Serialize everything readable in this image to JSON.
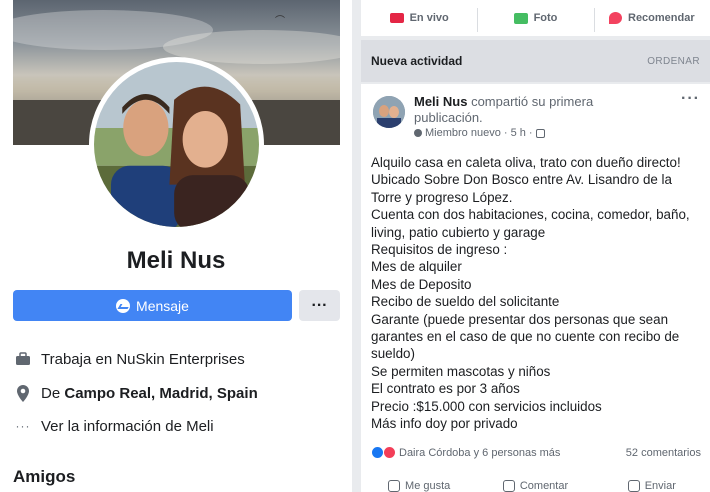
{
  "profile": {
    "name": "Meli Nus",
    "message_button": "Mensaje",
    "more_button": "···",
    "work": "Trabaja en NuSkin Enterprises",
    "location_prefix": "De ",
    "location": "Campo Real, Madrid, Spain",
    "see_info": "Ver la información de Meli",
    "friends_title": "Amigos"
  },
  "composer": {
    "live": "En vivo",
    "photo": "Foto",
    "recommend": "Recomendar"
  },
  "feed": {
    "title": "Nueva actividad",
    "order": "ORDENAR"
  },
  "post": {
    "author": "Meli Nus",
    "action_line1": " compartió su primera",
    "action_line2": "publicación.",
    "meta": "Miembro nuevo · 5 h ·",
    "more": "···",
    "lines": [
      "Alquilo casa en caleta oliva, trato con dueño directo!",
      "Ubicado Sobre Don Bosco entre Av. Lisandro de la",
      "Torre y progreso López.",
      "Cuenta con dos habitaciones, cocina, comedor, baño,",
      "living, patio cubierto y garage",
      "Requisitos de ingreso :",
      "Mes de alquiler",
      "Mes de Deposito",
      "Recibo de sueldo del solicitante",
      "Garante (puede presentar dos personas que sean",
      "garantes en el caso de que no cuente con recibo de",
      "sueldo)",
      "Se permiten mascotas y niños",
      "El contrato es por 3 años",
      "Precio :$15.000 con servicios incluidos",
      "Más info doy por privado"
    ],
    "reactions_text": "Daira Córdoba y 6 personas más",
    "comments": "52 comentarios",
    "actions": {
      "like": "Me gusta",
      "comment": "Comentar",
      "share": "Enviar"
    }
  },
  "colors": {
    "accent": "#4285f4",
    "page_bg": "#e9ebee",
    "header_bg": "#dcdee3"
  },
  "icons": [
    "messenger-icon",
    "briefcase-icon",
    "location-pin-icon",
    "more-dots-icon",
    "live-video-icon",
    "photo-icon",
    "recommend-icon",
    "globe-icon"
  ]
}
